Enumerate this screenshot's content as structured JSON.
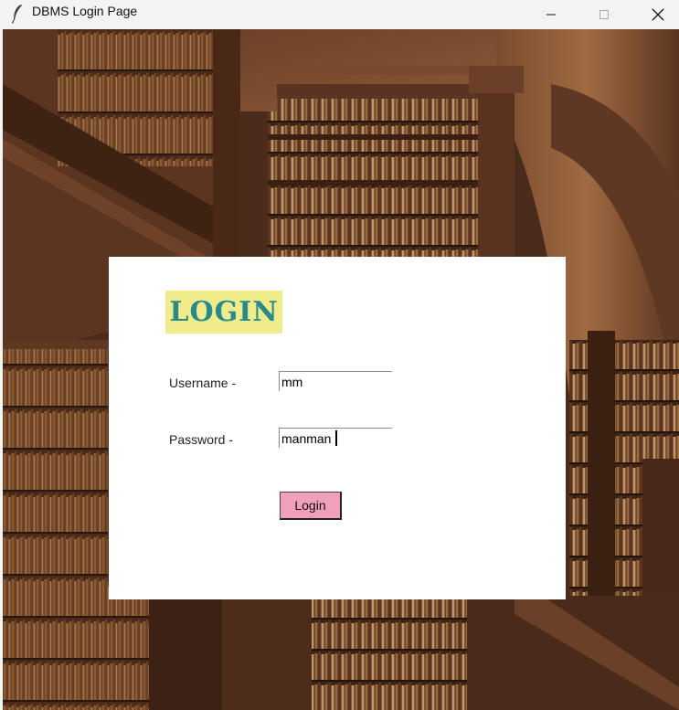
{
  "window": {
    "title": "DBMS Login Page",
    "app_icon": "feather-icon",
    "controls": [
      "minimize-icon",
      "maximize-icon",
      "close-icon"
    ]
  },
  "login": {
    "heading": "LOGIN",
    "username_label": "Username -",
    "username_value": "mm",
    "password_label": "Password -",
    "password_value": "manman",
    "button_label": "Login"
  },
  "colors": {
    "heading_bg": "#f0ec8c",
    "heading_text": "#2a8a8a",
    "button_bg": "#f0a0b8",
    "card_bg": "#ffffff"
  }
}
